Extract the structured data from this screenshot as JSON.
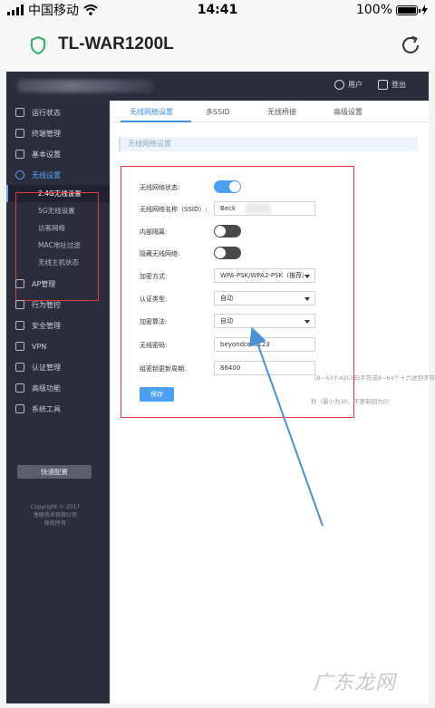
{
  "status_bar": {
    "carrier": "中国移动",
    "time": "14:41",
    "battery_percent": "100%",
    "battery_level": 1.0
  },
  "app": {
    "title": "TL-WAR1200L",
    "accent": "#3cb371"
  },
  "topbar": {
    "user_label": "用户",
    "logout_label": "登出"
  },
  "sidebar": {
    "items": [
      {
        "label": "运行状态",
        "icon": "monitor-icon"
      },
      {
        "label": "终端管理",
        "icon": "network-icon"
      },
      {
        "label": "基本设置",
        "icon": "gear-icon"
      },
      {
        "label": "无线设置",
        "icon": "wifi-icon"
      },
      {
        "label": "AP管理",
        "icon": "ap-icon"
      },
      {
        "label": "行为管控",
        "icon": "control-icon"
      },
      {
        "label": "安全管理",
        "icon": "shield-icon"
      },
      {
        "label": "VPN",
        "icon": "cloud-icon"
      },
      {
        "label": "认证管理",
        "icon": "auth-icon"
      },
      {
        "label": "高级功能",
        "icon": "grid-icon"
      },
      {
        "label": "系统工具",
        "icon": "tools-icon"
      }
    ],
    "sub_items": [
      {
        "label": "2.4G无线设置"
      },
      {
        "label": "5G无线设置"
      },
      {
        "label": "访客网络"
      },
      {
        "label": "MAC地址过滤"
      },
      {
        "label": "无线主机状态"
      }
    ],
    "quick_config": "快速配置",
    "copyright": [
      "Copyright © 2017",
      "普联技术有限公司",
      "版权所有"
    ]
  },
  "tabs": [
    {
      "label": "无线网络设置"
    },
    {
      "label": "多SSID"
    },
    {
      "label": "无线桥接"
    },
    {
      "label": "高级设置"
    }
  ],
  "section_title": "无线网络设置",
  "form": {
    "wireless_status": {
      "label": "无线网络状态:",
      "on": true
    },
    "ssid": {
      "label": "无线网络名称（SSID）:",
      "value": "Beck"
    },
    "isolation": {
      "label": "内部隔离:",
      "on": false
    },
    "hide_ssid": {
      "label": "隐藏无线网络:",
      "on": false
    },
    "encryption": {
      "label": "加密方式:",
      "value": "WPA-PSK/WPA2-PSK（推荐）"
    },
    "auth_type": {
      "label": "认证类型:",
      "value": "自动"
    },
    "cipher": {
      "label": "加密算法:",
      "value": "自动"
    },
    "password": {
      "label": "无线密码:",
      "value": "beyondcent123",
      "hint": "（8~63个ASCII码字符或8~64个十六进制字符）"
    },
    "rekey": {
      "label": "组密钥更新周期:",
      "value": "86400",
      "hint": "秒（最小为30，不更新则为0）"
    },
    "save_label": "保存"
  },
  "watermark": "广东龙网"
}
